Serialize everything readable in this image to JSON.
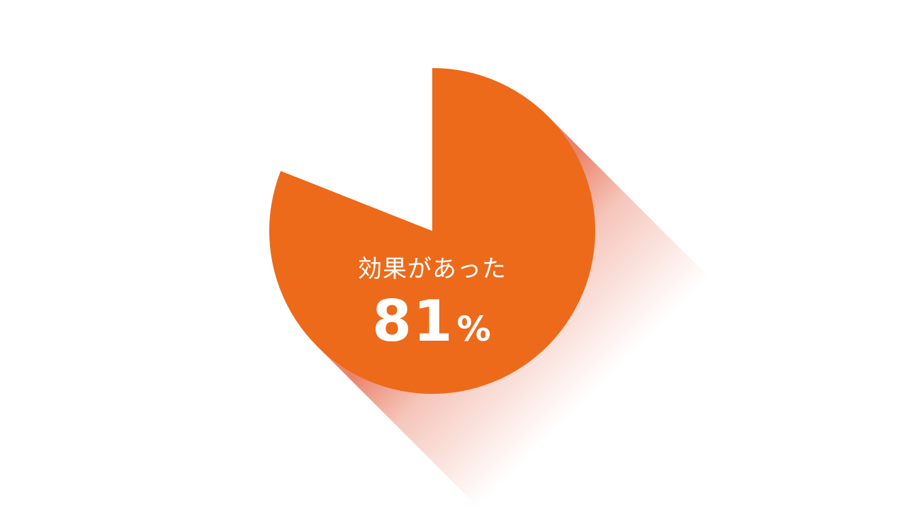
{
  "chart_data": {
    "type": "pie",
    "categories": [
      "効果があった"
    ],
    "values": [
      81
    ],
    "unit": "%",
    "colors": {
      "slice": "#EC6A1A",
      "shadow": "#E45A3A",
      "background": "#FFFFFF",
      "label": "#FFFFFF"
    },
    "grid": false,
    "legend": "none"
  }
}
